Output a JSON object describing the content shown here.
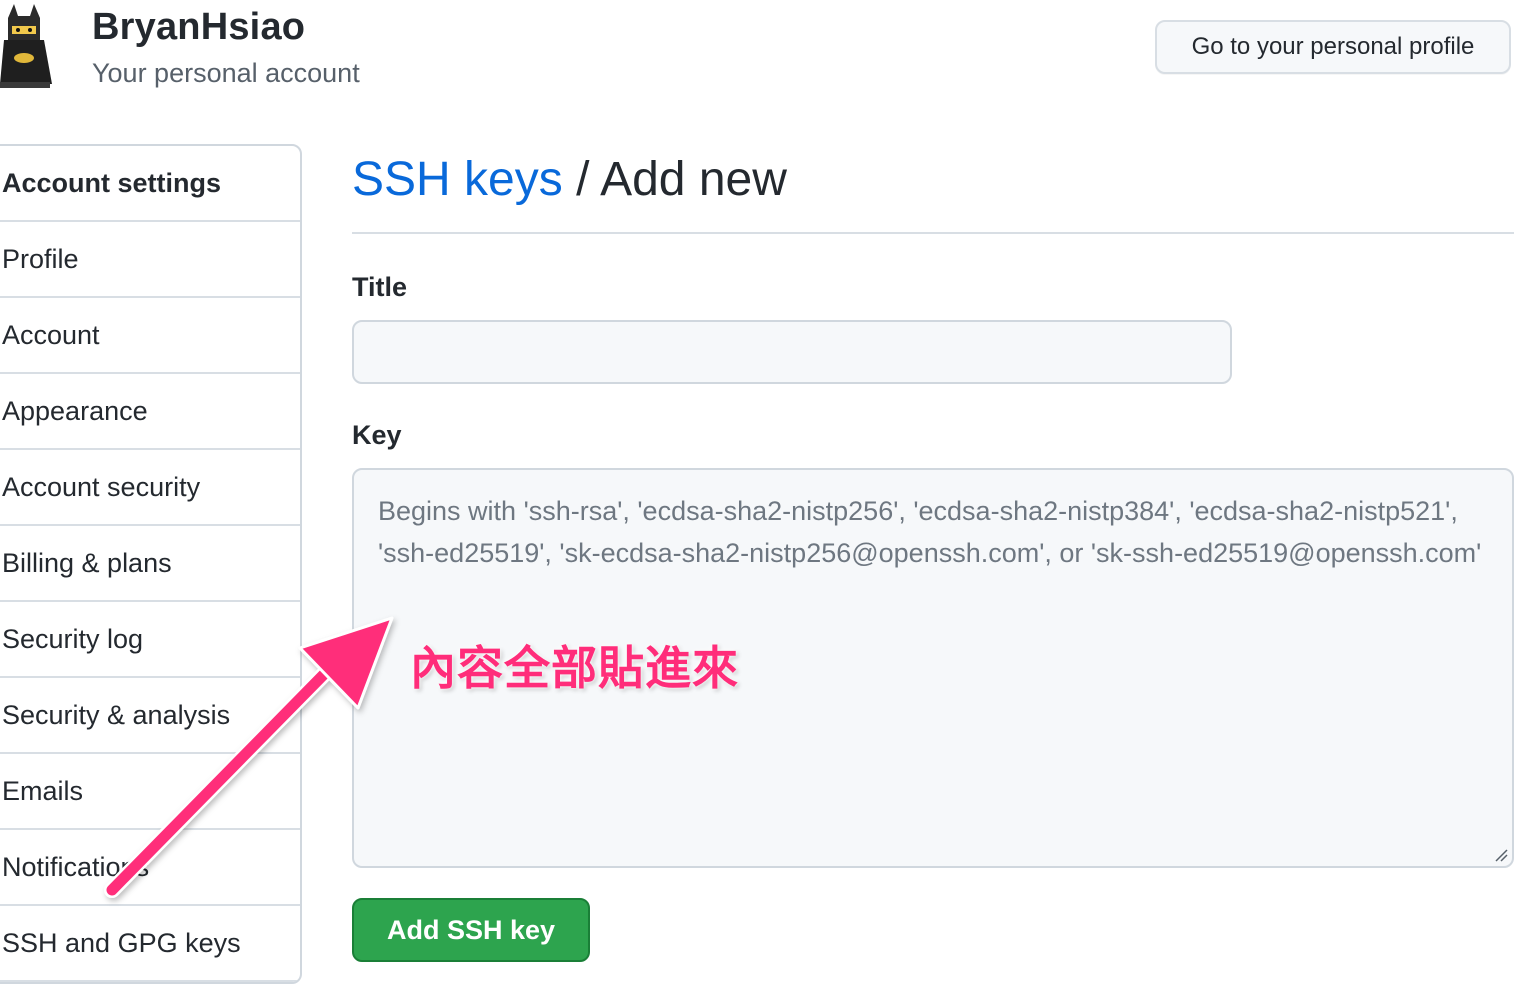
{
  "header": {
    "username": "BryanHsiao",
    "subtitle": "Your personal account",
    "profile_button": "Go to your personal profile"
  },
  "sidebar": {
    "heading": "Account settings",
    "items": [
      {
        "label": "Profile"
      },
      {
        "label": "Account"
      },
      {
        "label": "Appearance"
      },
      {
        "label": "Account security"
      },
      {
        "label": "Billing & plans"
      },
      {
        "label": "Security log"
      },
      {
        "label": "Security & analysis"
      },
      {
        "label": "Emails"
      },
      {
        "label": "Notifications"
      },
      {
        "label": "SSH and GPG keys"
      }
    ]
  },
  "main": {
    "breadcrumb_link": "SSH keys",
    "breadcrumb_sep": " / ",
    "breadcrumb_current": "Add new",
    "title_label": "Title",
    "title_value": "",
    "key_label": "Key",
    "key_placeholder": "Begins with 'ssh-rsa', 'ecdsa-sha2-nistp256', 'ecdsa-sha2-nistp384', 'ecdsa-sha2-nistp521', 'ssh-ed25519', 'sk-ecdsa-sha2-nistp256@openssh.com', or 'sk-ssh-ed25519@openssh.com'",
    "submit_label": "Add SSH key"
  },
  "annotation": {
    "text": "內容全部貼進來",
    "color": "#ff2d7a"
  },
  "colors": {
    "link": "#0969da",
    "primary_button": "#2da44e"
  }
}
